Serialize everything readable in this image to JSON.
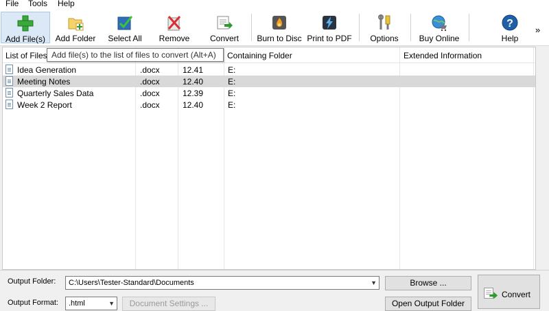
{
  "menu": {
    "items": [
      "File",
      "Tools",
      "Help"
    ]
  },
  "toolbar": {
    "buttons": [
      {
        "label": "Add File(s)",
        "icon": "plus-icon"
      },
      {
        "label": "Add Folder",
        "icon": "folder-add-icon"
      },
      {
        "label": "Select All",
        "icon": "checkbox-select-all-icon"
      },
      {
        "label": "Remove",
        "icon": "remove-x-icon"
      },
      {
        "label": "Convert",
        "icon": "convert-icon"
      },
      {
        "label": "Burn to Disc",
        "icon": "disc-flame-icon"
      },
      {
        "label": "Print to PDF",
        "icon": "lightning-pdf-icon"
      },
      {
        "label": "Options",
        "icon": "options-tools-icon"
      },
      {
        "label": "Buy Online",
        "icon": "globe-cart-icon"
      },
      {
        "label": "Help",
        "icon": "help-icon"
      }
    ],
    "overflow": "»"
  },
  "tooltip": "Add file(s) to the list of files to convert (Alt+A)",
  "file_list": {
    "columns": [
      "List of Files",
      "",
      "",
      "Containing Folder",
      "Extended Information"
    ],
    "rows": [
      {
        "name": "Idea Generation",
        "type": ".docx",
        "size": "12.41",
        "folder": "E:",
        "selected": false
      },
      {
        "name": "Meeting Notes",
        "type": ".docx",
        "size": "12.40",
        "folder": "E:",
        "selected": true
      },
      {
        "name": "Quarterly Sales Data",
        "type": ".docx",
        "size": "12.39",
        "folder": "E:",
        "selected": false
      },
      {
        "name": "Week 2 Report",
        "type": ".docx",
        "size": "12.40",
        "folder": "E:",
        "selected": false
      }
    ]
  },
  "bottom": {
    "output_folder_label": "Output Folder:",
    "output_folder_value": "C:\\Users\\Tester-Standard\\Documents",
    "browse_label": "Browse ...",
    "output_format_label": "Output Format:",
    "output_format_value": ".html",
    "document_settings_label": "Document Settings ...",
    "open_output_folder_label": "Open Output Folder",
    "convert_label": "Convert"
  },
  "colors": {
    "selected_row": "#d9d9d9",
    "active_button": "#dbe9f7",
    "green_accent": "#2e9a2e",
    "help_blue": "#1f5fa8"
  }
}
